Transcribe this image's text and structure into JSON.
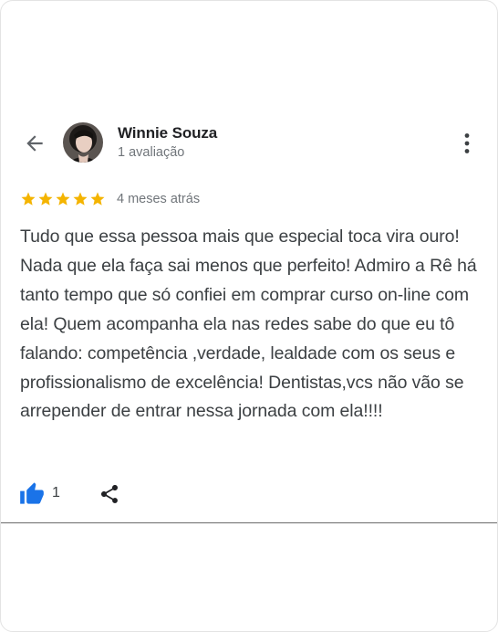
{
  "header": {
    "back_icon": "arrow-left-icon",
    "user_name": "Winnie Souza",
    "review_count": "1 avaliação",
    "more_icon": "more-vertical-icon"
  },
  "review": {
    "rating": 5,
    "max_rating": 5,
    "star_color": "#f4b400",
    "time": "4 meses atrás",
    "text": "Tudo que essa pessoa mais que especial toca vira ouro! Nada que ela faça sai menos que perfeito! Admiro a Rê há tanto tempo que só confiei em comprar curso on-line com ela! Quem acompanha ela nas redes sabe do que eu tô falando: competência ,verdade, lealdade com os seus e profissionalismo de excelência! Dentistas,vcs não vão se arrepender de entrar nessa jornada com ela!!!!"
  },
  "actions": {
    "like_icon": "thumbs-up-icon",
    "like_color": "#1a73e8",
    "like_count": "1",
    "share_icon": "share-icon"
  }
}
